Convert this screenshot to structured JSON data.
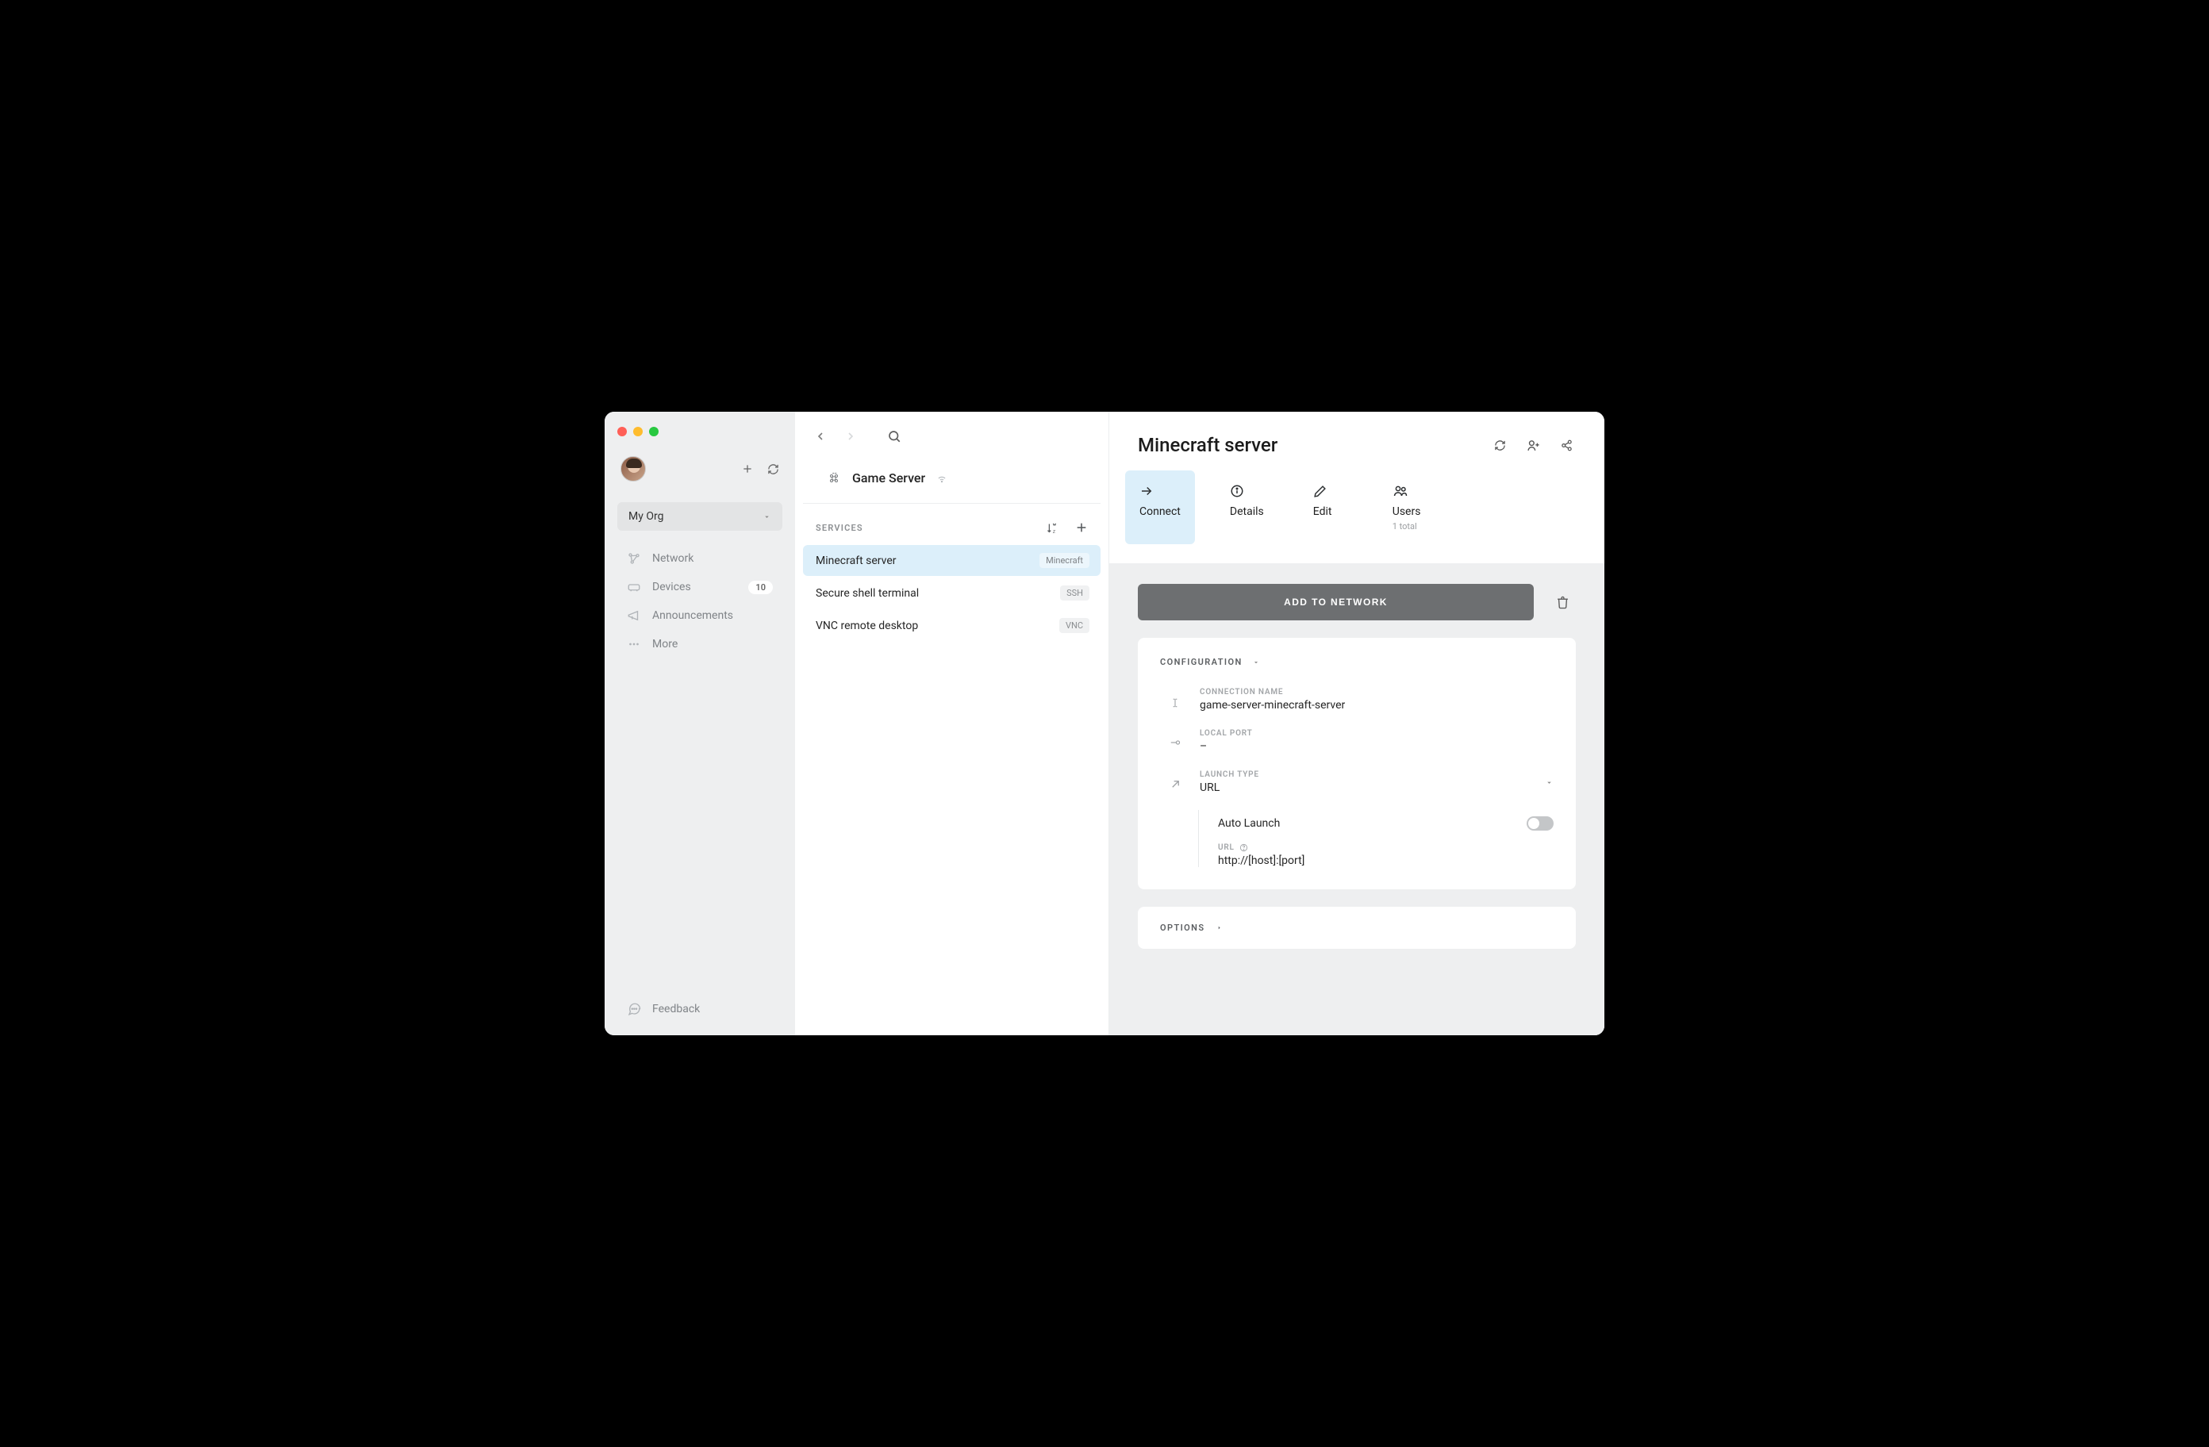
{
  "sidebar": {
    "org_label": "My Org",
    "nav": {
      "network": "Network",
      "devices": "Devices",
      "devices_badge": "10",
      "announcements": "Announcements",
      "more": "More"
    },
    "feedback": "Feedback"
  },
  "middle": {
    "device_name": "Game Server",
    "services_heading": "SERVICES",
    "services": [
      {
        "name": "Minecraft server",
        "tag": "Minecraft"
      },
      {
        "name": "Secure shell terminal",
        "tag": "SSH"
      },
      {
        "name": "VNC remote desktop",
        "tag": "VNC"
      }
    ]
  },
  "detail": {
    "title": "Minecraft server",
    "tabs": {
      "connect": "Connect",
      "details": "Details",
      "edit": "Edit",
      "users": "Users",
      "users_sub": "1 total"
    },
    "add_network_label": "ADD TO NETWORK",
    "configuration": {
      "heading": "CONFIGURATION",
      "connection_name_label": "CONNECTION NAME",
      "connection_name_value": "game-server-minecraft-server",
      "local_port_label": "LOCAL PORT",
      "local_port_value": "–",
      "launch_type_label": "LAUNCH TYPE",
      "launch_type_value": "URL",
      "auto_launch_label": "Auto Launch",
      "url_label": "URL",
      "url_value": "http://[host]:[port]"
    },
    "options_heading": "OPTIONS"
  }
}
